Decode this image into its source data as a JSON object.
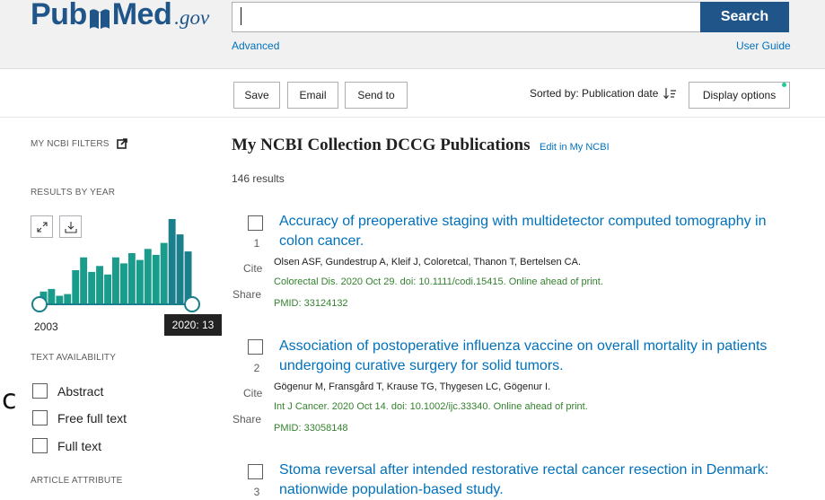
{
  "header": {
    "logo": {
      "pub": "Pub",
      "med": "Med",
      "gov": ".gov"
    },
    "search": {
      "placeholder": "",
      "value": "",
      "button_label": "Search"
    },
    "advanced_label": "Advanced",
    "user_guide_label": "User Guide"
  },
  "toolbar": {
    "save_label": "Save",
    "email_label": "Email",
    "send_to_label": "Send to",
    "sort_label": "Sorted by: Publication date",
    "display_options_label": "Display options"
  },
  "sidebar": {
    "my_ncbi_filters": "MY NCBI FILTERS",
    "results_by_year": "RESULTS BY YEAR",
    "timeline": {
      "start_year": "2003",
      "tooltip": "2020: 13",
      "bar_levels": [
        0.15,
        0.18,
        0.1,
        0.12,
        0.4,
        0.55,
        0.38,
        0.45,
        0.35,
        0.55,
        0.48,
        0.6,
        0.52,
        0.65,
        0.58,
        0.72,
        1.0,
        0.82,
        0.62
      ]
    },
    "text_availability": "TEXT AVAILABILITY",
    "filters": [
      {
        "label": "Abstract",
        "checked": false
      },
      {
        "label": "Free full text",
        "checked": false
      },
      {
        "label": "Full text",
        "checked": false
      }
    ],
    "article_attribute": "ARTICLE ATTRIBUTE"
  },
  "main": {
    "collection_title": "My NCBI Collection DCCG Publications",
    "edit_link": "Edit in My NCBI",
    "results_count": "146 results",
    "cite_label": "Cite",
    "share_label": "Share",
    "articles": [
      {
        "number": "1",
        "title_line1": "Accuracy of preoperative staging with multidetector computed tomography in",
        "title_line2": "colon cancer.",
        "authors": "Olsen ASF, Gundestrup A, Kleif J, Coloretcal, Thanon T, Bertelsen CA.",
        "journal": "Colorectal Dis. 2020 Oct 29. doi: 10.1111/codi.15415. Online ahead of print.",
        "pmid": "PMID: 33124132"
      },
      {
        "number": "2",
        "title_line1": "Association of postoperative influenza vaccine on overall mortality in patients",
        "title_line2": "undergoing curative surgery for solid tumors.",
        "authors": "Gögenur M, Fransgård T, Krause TG, Thygesen LC, Gögenur I.",
        "journal": "Int J Cancer. 2020 Oct 14. doi: 10.1002/ijc.33340. Online ahead of print.",
        "pmid": "PMID: 33058148"
      },
      {
        "number": "3",
        "title_line1": "Stoma reversal after intended restorative rectal cancer resection in Denmark:",
        "title_line2": "nationwide population-based study."
      }
    ]
  },
  "colors": {
    "brand": "#20558a",
    "link": "#0071bc",
    "journal_green": "#34822f",
    "bar_teal": "#1a9c8c"
  },
  "icons": [
    "external-link-icon",
    "expand-icon",
    "download-icon",
    "sort-descending-icon"
  ]
}
